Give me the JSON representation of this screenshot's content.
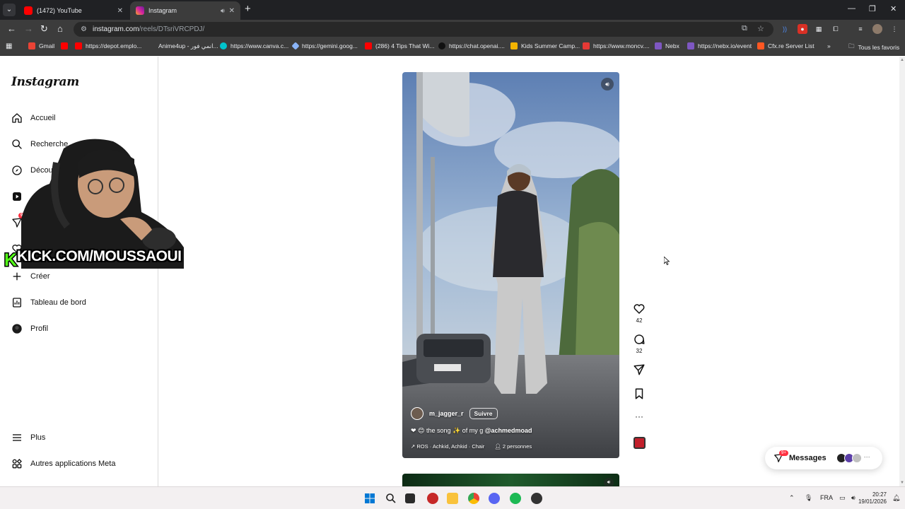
{
  "browser": {
    "tabs": [
      {
        "title": "(1472) YouTube",
        "active": false,
        "favicon_color": "#ff0000"
      },
      {
        "title": "Instagram",
        "active": true,
        "favicon_color": "#d6249f"
      }
    ],
    "url_host": "instagram.com",
    "url_path": "/reels/DTsriVRCPDJ/",
    "bookmarks": [
      {
        "label": "Gmail",
        "icon_color": "#ea4335"
      },
      {
        "label": "",
        "icon_color": "#ff0000"
      },
      {
        "label": "https://depot.emplo...",
        "icon_color": "#ff0000"
      },
      {
        "label": "Anime4up - انمي فور...",
        "icon_color": "#3c3c3c"
      },
      {
        "label": "https://www.canva.c...",
        "icon_color": "#00c4cc"
      },
      {
        "label": "https://gemini.goog...",
        "icon_color": "#8ab4f8"
      },
      {
        "label": "(286) 4 Tips That Wi...",
        "icon_color": "#ff0000"
      },
      {
        "label": "https://chat.openai....",
        "icon_color": "#202124"
      },
      {
        "label": "Kids Summer Camp...",
        "icon_color": "#f4b400"
      },
      {
        "label": "https://www.moncv....",
        "icon_color": "#e53935"
      },
      {
        "label": "Nebx",
        "icon_color": "#7e57c2"
      },
      {
        "label": "https://nebx.io/event",
        "icon_color": "#7e57c2"
      },
      {
        "label": "Cfx.re Server List",
        "icon_color": "#ff5722"
      }
    ],
    "all_bookmarks_label": "Tous les favoris"
  },
  "instagram": {
    "logo": "Instagram",
    "nav": [
      {
        "label": "Accueil",
        "icon": "home-icon"
      },
      {
        "label": "Recherche",
        "icon": "search-icon"
      },
      {
        "label": "Découvrir",
        "icon": "compass-icon"
      },
      {
        "label": "",
        "icon": "reels-icon"
      },
      {
        "label": "",
        "icon": "messages-icon"
      },
      {
        "label": "",
        "icon": "heart-icon"
      },
      {
        "label": "Créer",
        "icon": "plus-icon"
      },
      {
        "label": "Tableau de bord",
        "icon": "dashboard-icon"
      },
      {
        "label": "Profil",
        "icon": "profile-avatar"
      }
    ],
    "nav_badge": "9+",
    "more_label": "Plus",
    "meta_apps_label": "Autres applications Meta",
    "overlay_text": "KICK.COM/MOUSSAOUI",
    "reel": {
      "author": "m_jagger_r",
      "follow_label": "Suivre",
      "caption_prefix": "the song",
      "caption_middle": "of my g",
      "caption_mention": "@achmedmoad",
      "audio": "ROS · Achkid, Achkid · Chair",
      "people": "2 personnes",
      "likes": "42",
      "comments": "32"
    },
    "messages_label": "Messages",
    "messages_badge": "9+"
  },
  "taskbar": {
    "language": "FRA",
    "time": "20:27",
    "date": "19/01/2026"
  },
  "colors": {
    "chrome_dark": "#202124",
    "chrome_mid": "#3c3c3c",
    "badge_red": "#ff3040",
    "kick_green": "#53fc18"
  }
}
